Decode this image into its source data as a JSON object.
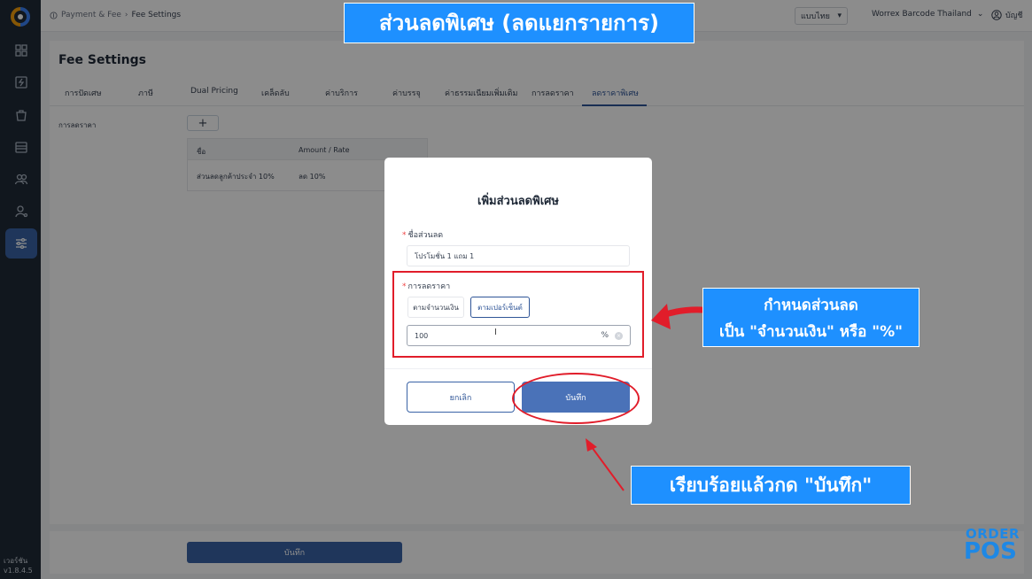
{
  "app": {
    "version_label": "เวอร์ชัน",
    "version_number": "v1.8.4.5"
  },
  "topbar": {
    "breadcrumb": [
      "Payment & Fee",
      "Fee Settings"
    ],
    "language": "แบบไทย",
    "store": "Worrex Barcode Thailand",
    "account": "บัญชี"
  },
  "page": {
    "title": "Fee Settings",
    "tabs": [
      "การปัดเศษ",
      "ภาษี",
      "Dual Pricing",
      "เคล็ดลับ",
      "ค่าบริการ",
      "ค่าบรรจุ",
      "ค่าธรรมเนียมเพิ่มเติม",
      "การลดราคา",
      "ลดราคาพิเศษ"
    ],
    "active_tab": "ลดราคาพิเศษ",
    "discount_label": "การลดราคา",
    "add_symbol": "+",
    "table": {
      "headers": [
        "ชื่อ",
        "Amount / Rate"
      ],
      "rows": [
        [
          "ส่วนลดลูกค้าประจำ 10%",
          "ลด 10%"
        ]
      ]
    },
    "save_label": "บันทึก"
  },
  "modal": {
    "title": "เพิ่มส่วนลดพิเศษ",
    "name_label": "ชื่อส่วนลด",
    "name_value": "โปรโมชั่น 1 แถม 1",
    "discount_label": "การลดราคา",
    "type_amount": "ตามจำนวนเงิน",
    "type_percent": "ตามเปอร์เซ็นต์",
    "selected_type": "ตามเปอร์เซ็นต์",
    "amount_value": "100",
    "unit": "%",
    "cancel_label": "ยกเลิก",
    "save_label": "บันทึก"
  },
  "callouts": {
    "title": "ส่วนลดพิเศษ (ลดแยกรายการ)",
    "amount_line1": "กำหนดส่วนลด",
    "amount_line2": "เป็น \"จำนวนเงิน\" หรือ \"%\"",
    "save": "เรียบร้อยแล้วกด \"บันทึก\""
  },
  "brand": {
    "top": "ORDER",
    "bottom": "POS"
  },
  "colors": {
    "sidebar": "#1f2a37",
    "primary": "#3a63a6",
    "callout": "#1e90ff",
    "highlight": "#e11d2a"
  }
}
